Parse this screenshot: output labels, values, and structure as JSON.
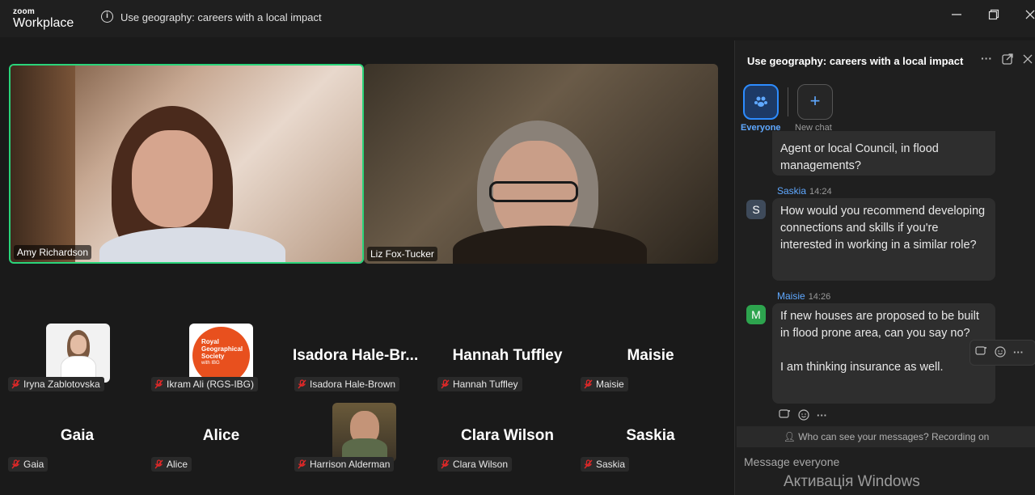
{
  "app": {
    "brand_top": "zoom",
    "brand_bottom": "Workplace",
    "meeting_title": "Use geography: careers with a local impact"
  },
  "video": {
    "speaker1": {
      "name": "Amy Richardson"
    },
    "speaker2": {
      "name": "Liz Fox-Tucker"
    },
    "participants": [
      {
        "display": "",
        "label": "Iryna Zablotovska"
      },
      {
        "display": "",
        "label": "Ikram Ali (RGS-IBG)"
      },
      {
        "display": "Isadora  Hale-Br...",
        "label": "Isadora Hale-Brown"
      },
      {
        "display": "Hannah Tuffley",
        "label": "Hannah Tuffley"
      },
      {
        "display": "Maisie",
        "label": "Maisie"
      },
      {
        "display": "Gaia",
        "label": "Gaia"
      },
      {
        "display": "Alice",
        "label": "Alice"
      },
      {
        "display": "",
        "label": "Harrison Alderman"
      },
      {
        "display": "Clara Wilson",
        "label": "Clara Wilson"
      },
      {
        "display": "Saskia",
        "label": "Saskia"
      }
    ],
    "rgs_logo": {
      "line1": "Royal",
      "line2": "Geographical",
      "line3": "Society",
      "line4": "with IBG"
    }
  },
  "chat": {
    "title": "Use geography: careers with a local impact",
    "tab_everyone": "Everyone",
    "tab_new": "New chat",
    "prev_bubble": "Agent or local Council, in flood managements?",
    "messages": [
      {
        "avatar": "S",
        "sender": "Saskia",
        "time": "14:24",
        "text": "How would you recommend developing connections and skills if you're interested in working in a similar role?"
      },
      {
        "avatar": "M",
        "sender": "Maisie",
        "time": "14:26",
        "text": "If new houses are proposed to be built in flood prone area, can you say no?\n\nI am thinking insurance as well."
      }
    ],
    "privacy": "Who can see your messages? Recording on",
    "input_placeholder": "Message everyone"
  },
  "os": {
    "watermark": "Активація Windows"
  },
  "colors": {
    "active_speaker": "#2ad47a",
    "accent": "#2d8cff",
    "muted_mic": "#e02828"
  }
}
